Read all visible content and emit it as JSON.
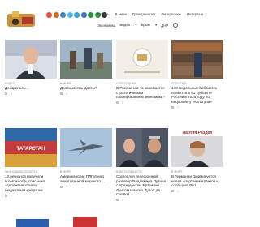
{
  "site": {
    "logo_icon": "site-logo"
  },
  "social_icons": [
    {
      "name": "vk-icon",
      "color": "#e84c3d"
    },
    {
      "name": "ok-icon",
      "color": "#c96a10"
    },
    {
      "name": "fb-icon",
      "color": "#3b7fc4"
    },
    {
      "name": "tw-icon",
      "color": "#52b6e8"
    },
    {
      "name": "yt-icon",
      "color": "#2ba3d6"
    },
    {
      "name": "ig-icon",
      "color": "#3d6db2"
    },
    {
      "name": "tg-icon",
      "color": "#27913f"
    },
    {
      "name": "rss-icon",
      "color": "#2a9f3b"
    },
    {
      "name": "mail-icon",
      "color": "#333333"
    }
  ],
  "nav": {
    "top": [
      "Власть",
      "В мире",
      "Гражданинтет",
      "Интересное",
      "Интервью"
    ],
    "sub": [
      "Экономика",
      "Видео",
      "Крым",
      "ДНР"
    ]
  },
  "cards": [
    {
      "cat": "ВИДЕО",
      "title": "Декорипись...",
      "date": "",
      "comments": "0"
    },
    {
      "cat": "В МИРЕ",
      "title": "Двойные стандарты?",
      "date": "",
      "comments": "0"
    },
    {
      "cat": "СОБЕСЕДНИК",
      "title": "В России кто-то занимается стратегическим планированием экономики?",
      "date": "",
      "comments": "0"
    },
    {
      "cat": "СОБЫТИЯ",
      "title": "149 модельных библиотек появятся в 51 субъекте России в 2024 году по нацпроекту «Культура»",
      "date": "",
      "comments": "0"
    },
    {
      "cat": "ЭКОНОМИКА ОБЛАСТИ",
      "title": "12 регионов получили возможность списания задолженности по бюджетным кредитам",
      "date": "",
      "comments": "0"
    },
    {
      "cat": "В МИРЕ",
      "title": "Американские ПЛПИ над авиагаванной морского ...",
      "date": "",
      "comments": "0"
    },
    {
      "cat": "ВЛАСТЬ ОБЛАСТИ",
      "title": "Состоялся телефонный разговор Владимира Путина с президентом Бразилии Луисом Инасио Лулой да Силвой",
      "date": "",
      "comments": "0"
    },
    {
      "cat": "В МИРЕ",
      "title": "В Германии формируется новая «партия мигрантов», сообщает Bild",
      "date": "",
      "comments": "0"
    }
  ],
  "thumb_texts": {
    "tatarstan": "ТАТАРСТАН",
    "ad_caption": "Партия Раздел"
  },
  "thumb_colors": {
    "c1": "#c7ccd6",
    "c2": "#8aa1b7",
    "c3": "#f0ece4",
    "c4": "#8a6d5a",
    "c5": "#b93a3a",
    "c6": "#9ab6d4",
    "c7": "#5a5f6b",
    "c8": "#9c9ca0"
  }
}
